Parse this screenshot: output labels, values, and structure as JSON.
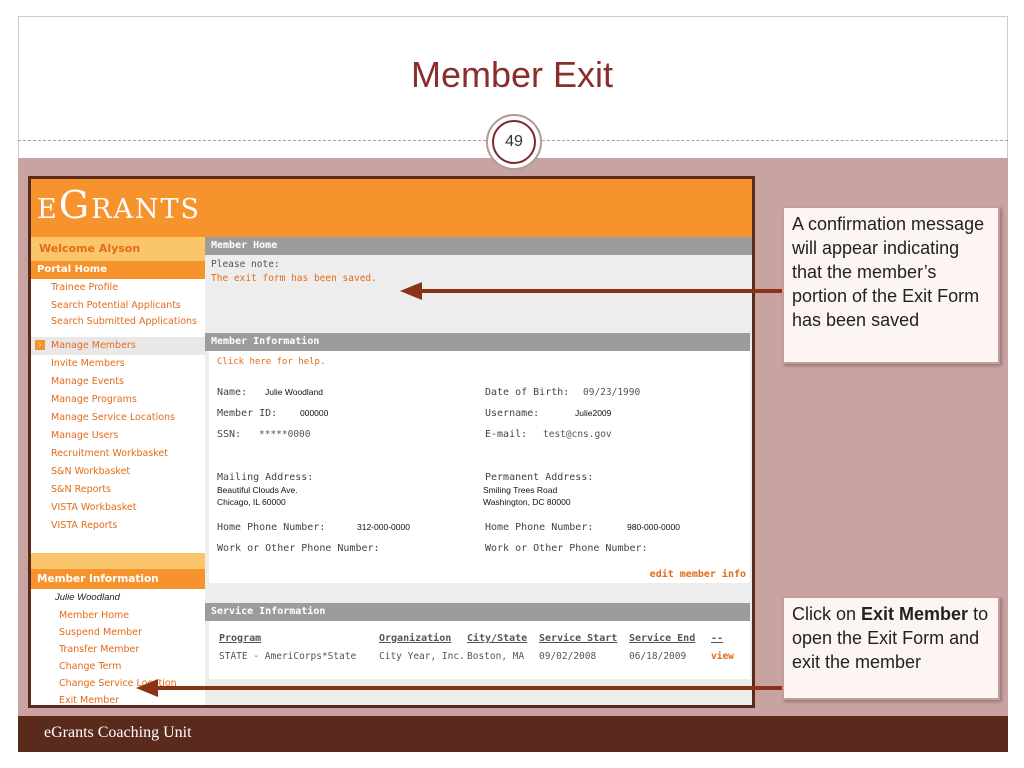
{
  "slide": {
    "title": "Member Exit",
    "page_number": "49",
    "footer": "eGrants Coaching Unit"
  },
  "app": {
    "logo": "eGrants",
    "sidebar": {
      "welcome": "Welcome Alyson",
      "portal_home": "Portal Home",
      "items": [
        "Trainee Profile",
        "Search Potential Applicants",
        "Search Submitted Applications",
        "Manage Members",
        "Invite Members",
        "Manage Events",
        "Manage Programs",
        "Manage Service Locations",
        "Manage Users",
        "Recruitment Workbasket",
        "S&N Workbasket",
        "S&N Reports",
        "VISTA Workbasket",
        "VISTA Reports"
      ],
      "member_section": "Member Information",
      "member_name": "Julie Woodland",
      "member_items": [
        "Member Home",
        "Suspend Member",
        "Transfer Member",
        "Change Term",
        "Change Service Location",
        "Exit Member"
      ]
    },
    "main": {
      "member_home_title": "Member Home",
      "note_label": "Please note:",
      "note_message": "The exit form has been saved.",
      "member_info_title": "Member Information",
      "help_link": "Click here for help.",
      "fields": {
        "name_label": "Name:",
        "name_value": "Julie Woodland",
        "dob_label": "Date of Birth:",
        "dob_value": "09/23/1990",
        "member_id_label": "Member ID:",
        "member_id_value": "000000",
        "username_label": "Username:",
        "username_value": "Julie2009",
        "ssn_label": "SSN:",
        "ssn_value": "*****0000",
        "email_label": "E-mail:",
        "email_value": "test@cns.gov",
        "mailing_label": "Mailing Address:",
        "mailing_line1": "Beautiful Clouds Ave.",
        "mailing_line2": "Chicago, IL 60000",
        "permanent_label": "Permanent Address:",
        "permanent_line1": "Smiling Trees Road",
        "permanent_line2": "Washington, DC 80000",
        "home_phone_label": "Home Phone Number:",
        "home_phone_value": "312-000-0000",
        "perm_home_phone_label": "Home Phone Number:",
        "perm_home_phone_value": "980-000-0000",
        "work_phone_label": "Work or Other Phone Number:",
        "perm_work_phone_label": "Work or Other Phone Number:"
      },
      "edit_link": "edit member info",
      "service_info_title": "Service Information",
      "service_table": {
        "headers": [
          "Program",
          "Organization",
          "City/State",
          "Service Start",
          "Service End",
          "--"
        ],
        "row": [
          "STATE - AmeriCorps*State",
          "City Year, Inc.",
          "Boston, MA",
          "09/02/2008",
          "06/18/2009",
          "view"
        ]
      }
    }
  },
  "callouts": {
    "confirmation": "A confirmation message will appear indicating that the member’s portion of the Exit Form has been saved",
    "exit_prefix": "Click on ",
    "exit_bold": "Exit Member",
    "exit_suffix": " to open the Exit Form and exit the member"
  },
  "colors": {
    "title": "#8a2d2d",
    "slide_background": "#c9a2a2",
    "footer": "#5a2a1c",
    "egrants_orange": "#f6932c",
    "arrow": "#8a3317"
  }
}
